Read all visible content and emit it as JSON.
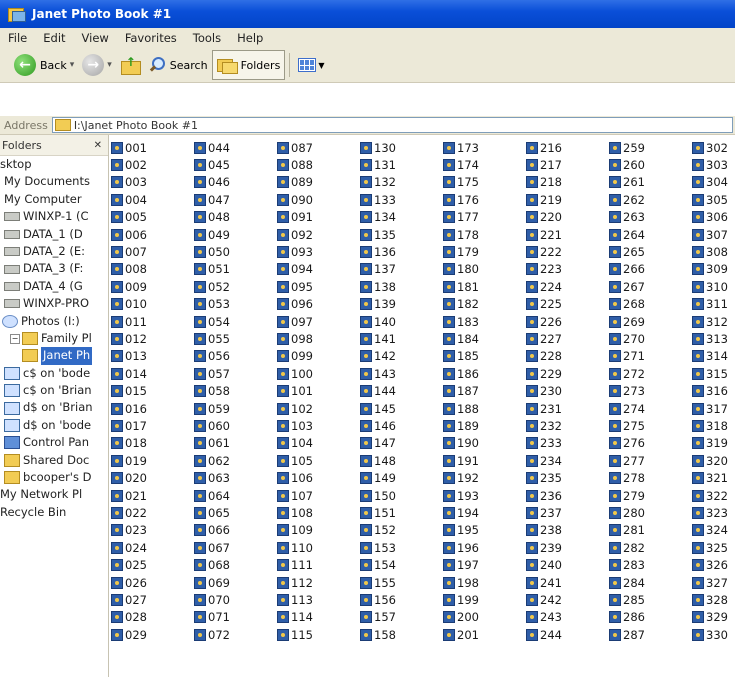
{
  "window": {
    "title": "Janet Photo Book #1"
  },
  "menu": [
    "File",
    "Edit",
    "View",
    "Favorites",
    "Tools",
    "Help"
  ],
  "toolbar": {
    "back_label": "Back",
    "search_label": "Search",
    "folders_label": "Folders"
  },
  "address": {
    "label": "Address",
    "path": "I:\\Janet Photo Book #1"
  },
  "left_pane": {
    "title": "Folders",
    "items": [
      {
        "label": "sktop",
        "icon": "none",
        "indent": 0
      },
      {
        "label": "My Documents",
        "icon": "none",
        "indent": 4
      },
      {
        "label": "My Computer",
        "icon": "none",
        "indent": 4
      },
      {
        "label": "WINXP-1 (C",
        "icon": "drive-icon",
        "indent": 4
      },
      {
        "label": "DATA_1 (D",
        "icon": "drive-icon",
        "indent": 4
      },
      {
        "label": "DATA_2 (E:",
        "icon": "drive-icon",
        "indent": 4
      },
      {
        "label": "DATA_3 (F:",
        "icon": "drive-icon",
        "indent": 4
      },
      {
        "label": "DATA_4 (G",
        "icon": "drive-icon",
        "indent": 4
      },
      {
        "label": "WINXP-PRO",
        "icon": "drive-icon",
        "indent": 4
      },
      {
        "label": "Photos (I:)",
        "icon": "photo-drive-icon",
        "indent": 2
      },
      {
        "label": "Family Pl",
        "icon": "folder-icon",
        "indent": 10,
        "expand": "−"
      },
      {
        "label": "Janet Ph",
        "icon": "folder-icon",
        "indent": 22,
        "selected": true
      },
      {
        "label": "c$ on 'bode",
        "icon": "network-drive-icon",
        "indent": 4
      },
      {
        "label": "c$ on 'Brian",
        "icon": "network-drive-icon",
        "indent": 4
      },
      {
        "label": "d$ on 'Brian",
        "icon": "network-drive-icon",
        "indent": 4
      },
      {
        "label": "d$ on 'bode",
        "icon": "network-drive-icon",
        "indent": 4
      },
      {
        "label": "Control Pan",
        "icon": "control-panel-icon",
        "indent": 4
      },
      {
        "label": "Shared Doc",
        "icon": "folder-icon",
        "indent": 4
      },
      {
        "label": "bcooper's D",
        "icon": "folder-icon",
        "indent": 4
      },
      {
        "label": "My Network Pl",
        "icon": "none",
        "indent": 0
      },
      {
        "label": "Recycle Bin",
        "icon": "none",
        "indent": 0
      }
    ]
  },
  "files": {
    "columns": 8,
    "rows": 30,
    "icon": "image-file-icon",
    "names": [
      "001",
      "002",
      "003",
      "004",
      "005",
      "006",
      "007",
      "008",
      "009",
      "010",
      "011",
      "012",
      "013",
      "014",
      "015",
      "016",
      "017",
      "018",
      "019",
      "020",
      "021",
      "022",
      "023",
      "024",
      "025",
      "026",
      "027",
      "028",
      "029",
      "044",
      "045",
      "046",
      "047",
      "048",
      "049",
      "050",
      "051",
      "052",
      "053",
      "054",
      "055",
      "056",
      "057",
      "058",
      "059",
      "060",
      "061",
      "062",
      "063",
      "064",
      "065",
      "066",
      "067",
      "068",
      "069",
      "070",
      "071",
      "072",
      "087",
      "088",
      "089",
      "090",
      "091",
      "092",
      "093",
      "094",
      "095",
      "096",
      "097",
      "098",
      "099",
      "100",
      "101",
      "102",
      "103",
      "104",
      "105",
      "106",
      "107",
      "108",
      "109",
      "110",
      "111",
      "112",
      "113",
      "114",
      "115",
      "130",
      "131",
      "132",
      "133",
      "134",
      "135",
      "136",
      "137",
      "138",
      "139",
      "140",
      "141",
      "142",
      "143",
      "144",
      "145",
      "146",
      "147",
      "148",
      "149",
      "150",
      "151",
      "152",
      "153",
      "154",
      "155",
      "156",
      "157",
      "158",
      "173",
      "174",
      "175",
      "176",
      "177",
      "178",
      "179",
      "180",
      "181",
      "182",
      "183",
      "184",
      "185",
      "186",
      "187",
      "188",
      "189",
      "190",
      "191",
      "192",
      "193",
      "194",
      "195",
      "196",
      "197",
      "198",
      "199",
      "200",
      "201",
      "216",
      "217",
      "218",
      "219",
      "220",
      "221",
      "222",
      "223",
      "224",
      "225",
      "226",
      "227",
      "228",
      "229",
      "230",
      "231",
      "232",
      "233",
      "234",
      "235",
      "236",
      "237",
      "238",
      "239",
      "240",
      "241",
      "242",
      "243",
      "244",
      "259",
      "260",
      "261",
      "262",
      "263",
      "264",
      "265",
      "266",
      "267",
      "268",
      "269",
      "270",
      "271",
      "272",
      "273",
      "274",
      "275",
      "276",
      "277",
      "278",
      "279",
      "280",
      "281",
      "282",
      "283",
      "284",
      "285",
      "286",
      "287",
      "302",
      "303",
      "304",
      "305",
      "306",
      "307",
      "308",
      "309",
      "310",
      "311",
      "312",
      "313",
      "314",
      "315",
      "316",
      "317",
      "318",
      "319",
      "320",
      "321",
      "322",
      "323",
      "324",
      "325",
      "326",
      "327",
      "328",
      "329",
      "330"
    ]
  }
}
